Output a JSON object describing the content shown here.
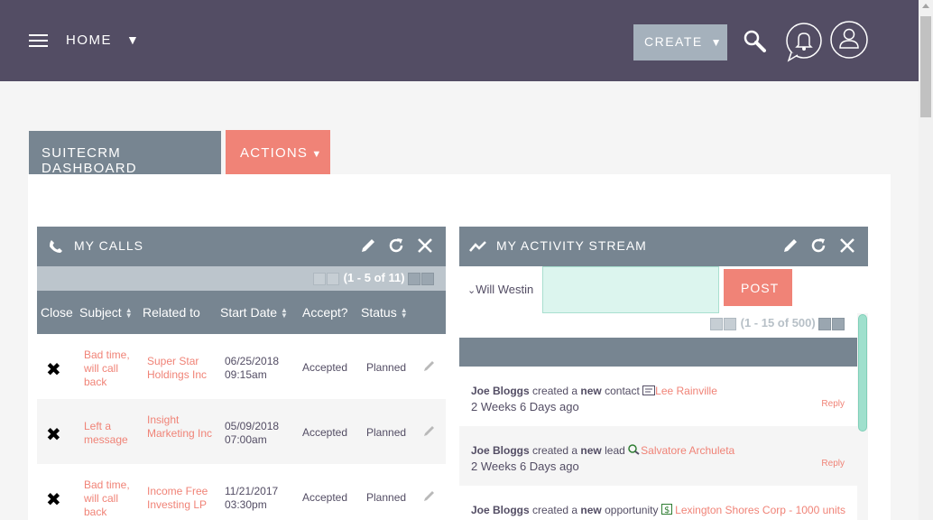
{
  "nav": {
    "home_label": "HOME",
    "create_label": "CREATE"
  },
  "tabs": {
    "dashboard": "SUITECRM DASHBOARD",
    "actions": "ACTIONS"
  },
  "calls": {
    "title": "MY CALLS",
    "pagination": "(1 - 5 of 11)",
    "columns": [
      "Close",
      "Subject",
      "Related to",
      "Start Date",
      "Accept?",
      "Status"
    ],
    "rows": [
      {
        "subject": "Bad time, will call back",
        "related": "Super Star Holdings Inc",
        "date": "06/25/2018",
        "time": "09:15am",
        "accept": "Accepted",
        "status": "Planned"
      },
      {
        "subject": "Left a message",
        "related": "Insight Marketing Inc",
        "date": "05/09/2018",
        "time": "07:00am",
        "accept": "Accepted",
        "status": "Planned"
      },
      {
        "subject": "Bad time, will call back",
        "related": "Income Free Investing LP",
        "date": "11/21/2017",
        "time": "03:30pm",
        "accept": "Accepted",
        "status": "Planned"
      }
    ]
  },
  "activity": {
    "title": "MY ACTIVITY STREAM",
    "user": "Will Westin",
    "post_label": "POST",
    "pagination": "(1 - 15 of 500)",
    "entries": [
      {
        "actor": "Joe Bloggs",
        "verb": "created a",
        "new_word": "new",
        "module": "contact",
        "icon": "contact-card-icon",
        "record": "Lee Rainville",
        "when": "2 Weeks 6 Days ago",
        "reply": "Reply"
      },
      {
        "actor": "Joe Bloggs",
        "verb": "created a",
        "new_word": "new",
        "module": "lead",
        "icon": "lead-search-icon",
        "record": "Salvatore Archuleta",
        "when": "2 Weeks 6 Days ago",
        "reply": "Reply"
      },
      {
        "actor": "Joe Bloggs",
        "verb": "created a",
        "new_word": "new",
        "module": "opportunity",
        "icon": "dollar-icon",
        "record": "Lexington Shores Corp - 1000 units",
        "when": "",
        "reply": ""
      }
    ]
  },
  "colors": {
    "topbar": "#534d64",
    "accent": "#f08377",
    "header": "#778591",
    "post_input": "#dcf5ee"
  }
}
